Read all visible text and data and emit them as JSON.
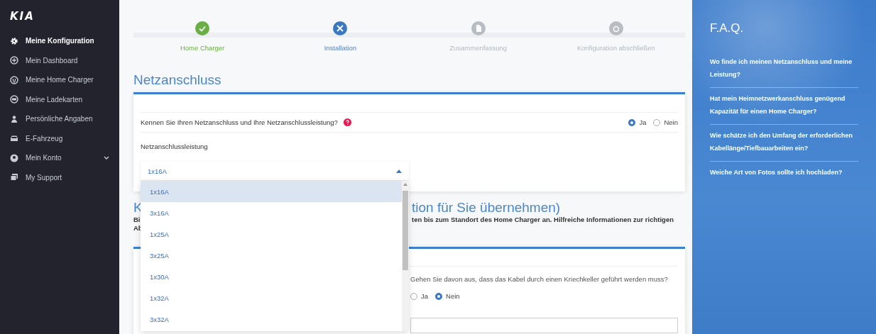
{
  "sidebar": {
    "logo": "KIA",
    "items": [
      {
        "label": "Meine Konfiguration",
        "kind": "link",
        "selected": true
      },
      {
        "label": "Mein Dashboard",
        "kind": "link",
        "selected": false
      },
      {
        "label": "Meine Home Charger",
        "kind": "link",
        "selected": false
      },
      {
        "label": "Meine Ladekarten",
        "kind": "link",
        "selected": false
      },
      {
        "label": "Persönliche Angaben",
        "kind": "link",
        "selected": false
      },
      {
        "label": "E-Fahrzeug",
        "kind": "link",
        "selected": false
      },
      {
        "label": "Mein Konto",
        "kind": "group",
        "selected": false,
        "expanded": false
      },
      {
        "label": "My Support",
        "kind": "link",
        "selected": false
      }
    ]
  },
  "stepper": {
    "steps": [
      {
        "label": "Home Charger",
        "kind": "done"
      },
      {
        "label": "Installation",
        "kind": "active"
      },
      {
        "label": "Zusammenfassung",
        "kind": "todo"
      },
      {
        "label": "Konfiguration abschließen",
        "kind": "todo"
      }
    ]
  },
  "netzanschluss": {
    "title": "Netzanschluss",
    "question": "Kennen Sie Ihren Netzanschluss und Ihre Netzanschlussleistung?",
    "options": [
      {
        "label": "Ja",
        "selected": true
      },
      {
        "label": "Nein",
        "selected": false
      }
    ],
    "field_label": "Netzanschlussleistung",
    "select": {
      "value": "1x16A",
      "expanded": true,
      "options": [
        {
          "label": "1x16A",
          "selected": true
        },
        {
          "label": "3x16A",
          "selected": false
        },
        {
          "label": "1x25A",
          "selected": false
        },
        {
          "label": "3x25A",
          "selected": false
        },
        {
          "label": "1x30A",
          "selected": false
        },
        {
          "label": "1x32A",
          "selected": false
        },
        {
          "label": "3x32A",
          "selected": false
        }
      ]
    }
  },
  "cable_section": {
    "heading_start": "K",
    "heading_end": "tion für Sie übernehmen)",
    "text_lines": [
      {
        "start": "Bi",
        "end": "ten bis zum Standort des Home Charger an. Hilfreiche Informationen zur richtigen"
      },
      {
        "start": "Ab"
      }
    ],
    "question": "Gehen Sie davon aus, dass das Kabel durch einen Kriechkeller geführt werden muss?",
    "options": [
      {
        "label": "Ja",
        "selected": false
      },
      {
        "label": "Nein",
        "selected": true
      }
    ]
  },
  "faq": {
    "title": "F.A.Q.",
    "items": [
      "Wo finde ich meinen Netzanschluss und meine Leistung?",
      "Hat mein Heimnetzwerkanschluss genügend Kapazität für einen Home Charger?",
      "Wie schätze ich den Umfang der erforderlichen Kabellänge/Tiefbauarbeiten ein?",
      "Weiche Art von Fotos sollte ich hochladen?"
    ]
  }
}
